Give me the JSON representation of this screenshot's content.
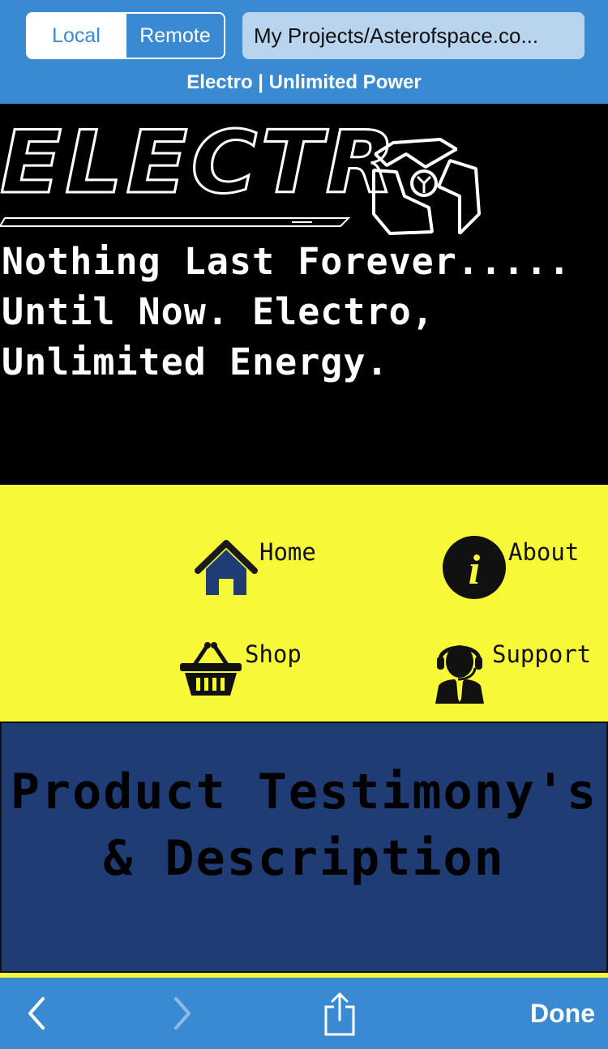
{
  "browser": {
    "segment": {
      "local_label": "Local",
      "remote_label": "Remote",
      "selected": "Local"
    },
    "address": "My Projects/Asterofspace.co...",
    "page_title": "Electro | Unlimited Power",
    "toolbar": {
      "done_label": "Done"
    }
  },
  "hero": {
    "logo_text": "ELECTR",
    "tagline": "Nothing Last Forever..... Until Now. Electro, Unlimited Energy."
  },
  "nav": {
    "items": [
      {
        "label": "Home",
        "icon": "home-icon"
      },
      {
        "label": "About",
        "icon": "info-icon"
      },
      {
        "label": "Shop",
        "icon": "basket-icon"
      },
      {
        "label": "Support",
        "icon": "support-agent-icon"
      }
    ]
  },
  "product": {
    "heading": "Product Testimony's & Description"
  },
  "colors": {
    "chrome_blue": "#3a8ad2",
    "nav_yellow": "#f7f838",
    "product_navy": "#1f3c75",
    "hero_black": "#000000"
  }
}
